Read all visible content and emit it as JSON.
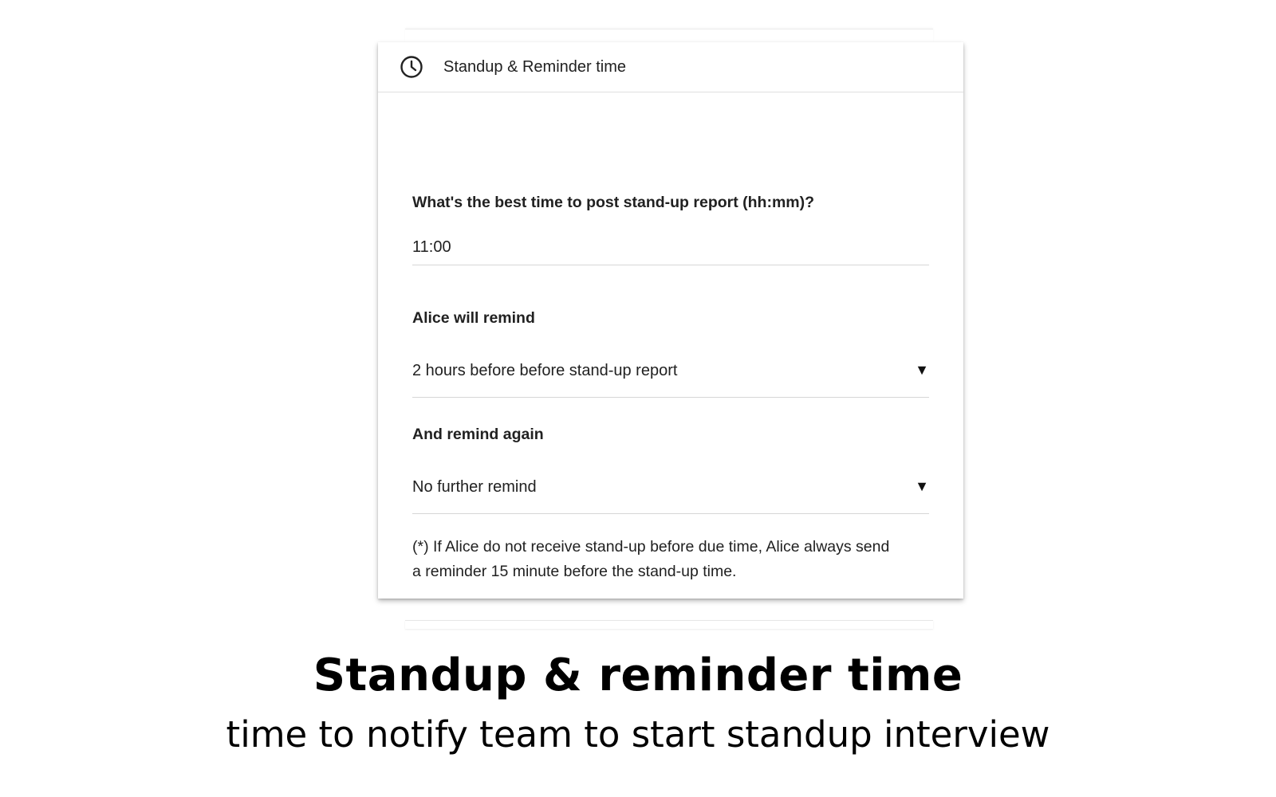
{
  "card": {
    "header": {
      "icon": "clock-icon",
      "title": "Standup & Reminder time"
    },
    "post_time": {
      "label": "What's the best time to post stand-up report (hh:mm)?",
      "value": "11:00"
    },
    "first_reminder": {
      "label": "Alice will remind",
      "selected": "2 hours before before  stand-up report",
      "arrow_icon": "dropdown-arrow-icon"
    },
    "second_reminder": {
      "label": "And remind again",
      "selected": "No further remind",
      "arrow_icon": "dropdown-arrow-icon"
    },
    "note": {
      "line1": "(*) If Alice do not receive stand-up before due time, Alice always send",
      "line2": "a reminder 15 minute before the stand-up time."
    }
  },
  "caption": {
    "title": "Standup & reminder time",
    "subtitle": "time to notify team to start standup interview"
  },
  "colors": {
    "text": "#212121",
    "divider": "#d6d6d6",
    "background": "#ffffff"
  }
}
